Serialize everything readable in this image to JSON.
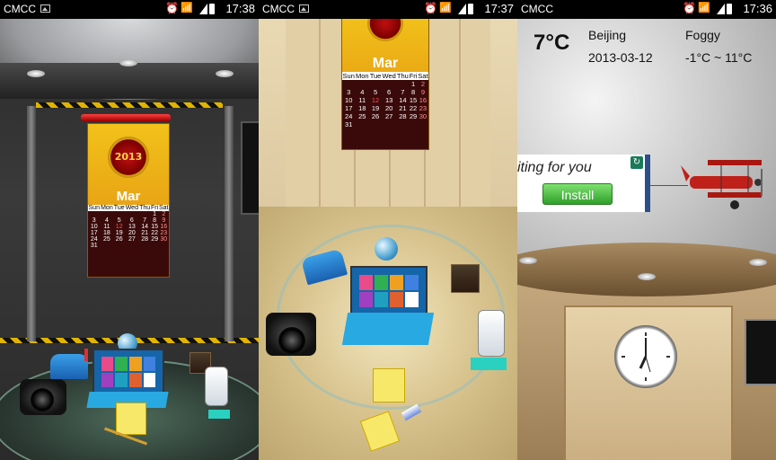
{
  "status_bar": [
    {
      "carrier": "CMCC",
      "time": "17:38"
    },
    {
      "carrier": "CMCC",
      "time": "17:37"
    },
    {
      "carrier": "CMCC",
      "time": "17:36"
    }
  ],
  "calendar": {
    "year": "2013",
    "month": "Mar",
    "weekdays": [
      "Sun",
      "Mon",
      "Tue",
      "Wed",
      "Thu",
      "Fri",
      "Sat"
    ],
    "weeks": [
      [
        "",
        "",
        "",
        "",
        "",
        "1",
        "2"
      ],
      [
        "3",
        "4",
        "5",
        "6",
        "7",
        "8",
        "9"
      ],
      [
        "10",
        "11",
        "12",
        "13",
        "14",
        "15",
        "16"
      ],
      [
        "17",
        "18",
        "19",
        "20",
        "21",
        "22",
        "23"
      ],
      [
        "24",
        "25",
        "26",
        "27",
        "28",
        "29",
        "30"
      ],
      [
        "31",
        "",
        "",
        "",
        "",
        "",
        ""
      ]
    ]
  },
  "weather": {
    "temperature": "7°C",
    "city": "Beijing",
    "condition": "Foggy",
    "date": "2013-03-12",
    "range": "-1°C ~ 11°C"
  },
  "ad": {
    "text": "iting for you",
    "button": "Install"
  },
  "colors": {
    "accent_gold": "#f2c21a",
    "tile_blue": "#1565a8",
    "ad_green": "#2fa02a"
  }
}
